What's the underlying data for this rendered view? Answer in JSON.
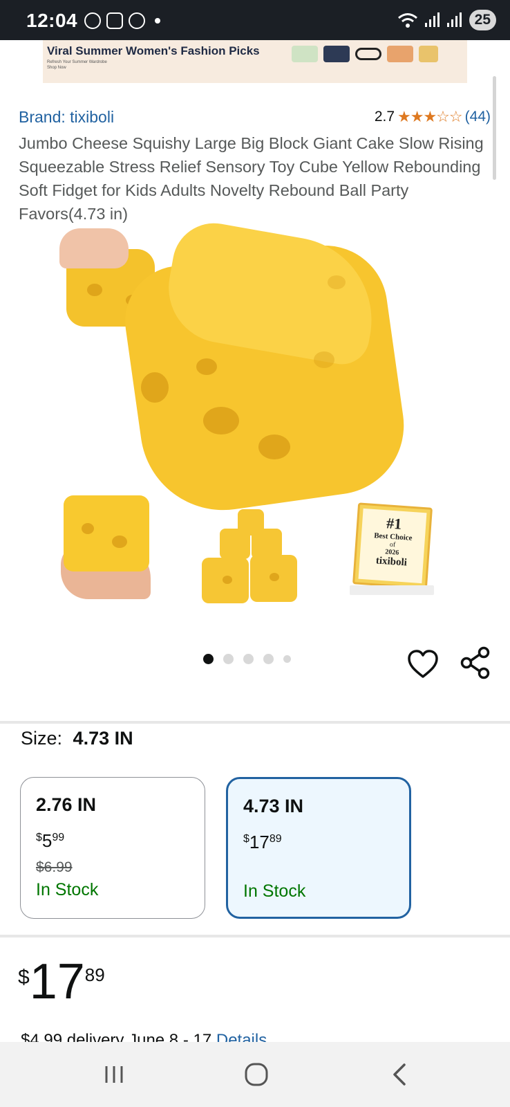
{
  "status_bar": {
    "time": "12:04",
    "battery": "25"
  },
  "ad_banner": {
    "title": "Viral Summer Women's Fashion Picks",
    "subtitle": "Refresh Your Summer Wardrobe Shop Now"
  },
  "product": {
    "brand": "Brand: tixiboli",
    "rating_value": "2.7",
    "rating_stars": "★★★☆☆",
    "rating_fraction": 0.54,
    "rating_count": "(44)",
    "title": "Jumbo Cheese Squishy Large Big Block Giant Cake Slow Rising Squeezable Stress Relief Sensory Toy Cube Yellow Rebounding Soft Fidget for Kids Adults Novelty Rebound Ball Party Favors(4.73 in)"
  },
  "gallery": {
    "badge_rank": "#1",
    "badge_line1": "Best Choice",
    "badge_line2": "of",
    "badge_year": "2026",
    "badge_brand": "tixiboli",
    "page_count": 5,
    "active_page": 1
  },
  "size": {
    "label": "Size:",
    "selected_value": "4.73 IN",
    "options": [
      {
        "name": "2.76 IN",
        "currency": "$",
        "price_whole": "5",
        "price_frac": "99",
        "was_price": "$6.99",
        "stock": "In Stock"
      },
      {
        "name": "4.73 IN",
        "currency": "$",
        "price_whole": "17",
        "price_frac": "89",
        "was_price": "",
        "stock": "In Stock"
      }
    ]
  },
  "price": {
    "currency": "$",
    "whole": "17",
    "fraction": "89"
  },
  "delivery": {
    "text": "$4.99 delivery June 8 - 17",
    "details_link": "Details"
  },
  "colors": {
    "link": "#2162a1",
    "stock_green": "#007600",
    "star": "#de7921",
    "cheese": "#f6c634"
  }
}
